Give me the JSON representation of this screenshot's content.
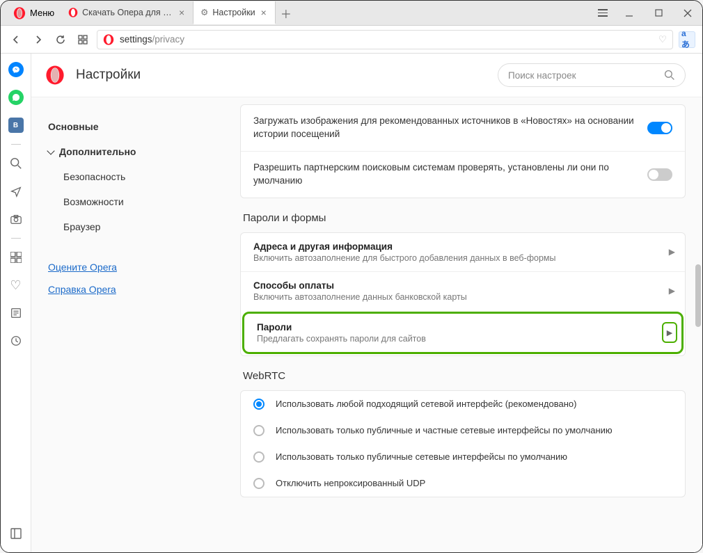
{
  "titlebar": {
    "menu_label": "Меню",
    "tabs": [
      {
        "title": "Скачать Опера для компьютера"
      },
      {
        "title": "Настройки"
      }
    ]
  },
  "addressbar": {
    "url_prefix": "settings",
    "url_path": "/privacy"
  },
  "page": {
    "title": "Настройки",
    "search_placeholder": "Поиск настроек"
  },
  "sidebar": {
    "items": {
      "basic": "Основные",
      "advanced": "Дополнительно",
      "security": "Безопасность",
      "features": "Возможности",
      "browser": "Браузер"
    },
    "links": {
      "rate": "Оцените Opera",
      "help": "Справка Opera"
    }
  },
  "settings": {
    "toggles": {
      "news_images": "Загружать изображения для рекомендованных источников в «Новостях» на основании истории посещений",
      "partner_search": "Разрешить партнерским поисковым системам проверять, установлены ли они по умолчанию"
    },
    "passwords_forms": {
      "heading": "Пароли и формы",
      "addresses": {
        "title": "Адреса и другая информация",
        "sub": "Включить автозаполнение для быстрого добавления данных в веб-формы"
      },
      "payments": {
        "title": "Способы оплаты",
        "sub": "Включить автозаполнение данных банковской карты"
      },
      "passwords": {
        "title": "Пароли",
        "sub": "Предлагать сохранять пароли для сайтов"
      }
    },
    "webrtc": {
      "heading": "WebRTC",
      "opt1": "Использовать любой подходящий сетевой интерфейс (рекомендовано)",
      "opt2": "Использовать только публичные и частные сетевые интерфейсы по умолчанию",
      "opt3": "Использовать только публичные сетевые интерфейсы по умолчанию",
      "opt4": "Отключить непроксированный UDP"
    }
  }
}
